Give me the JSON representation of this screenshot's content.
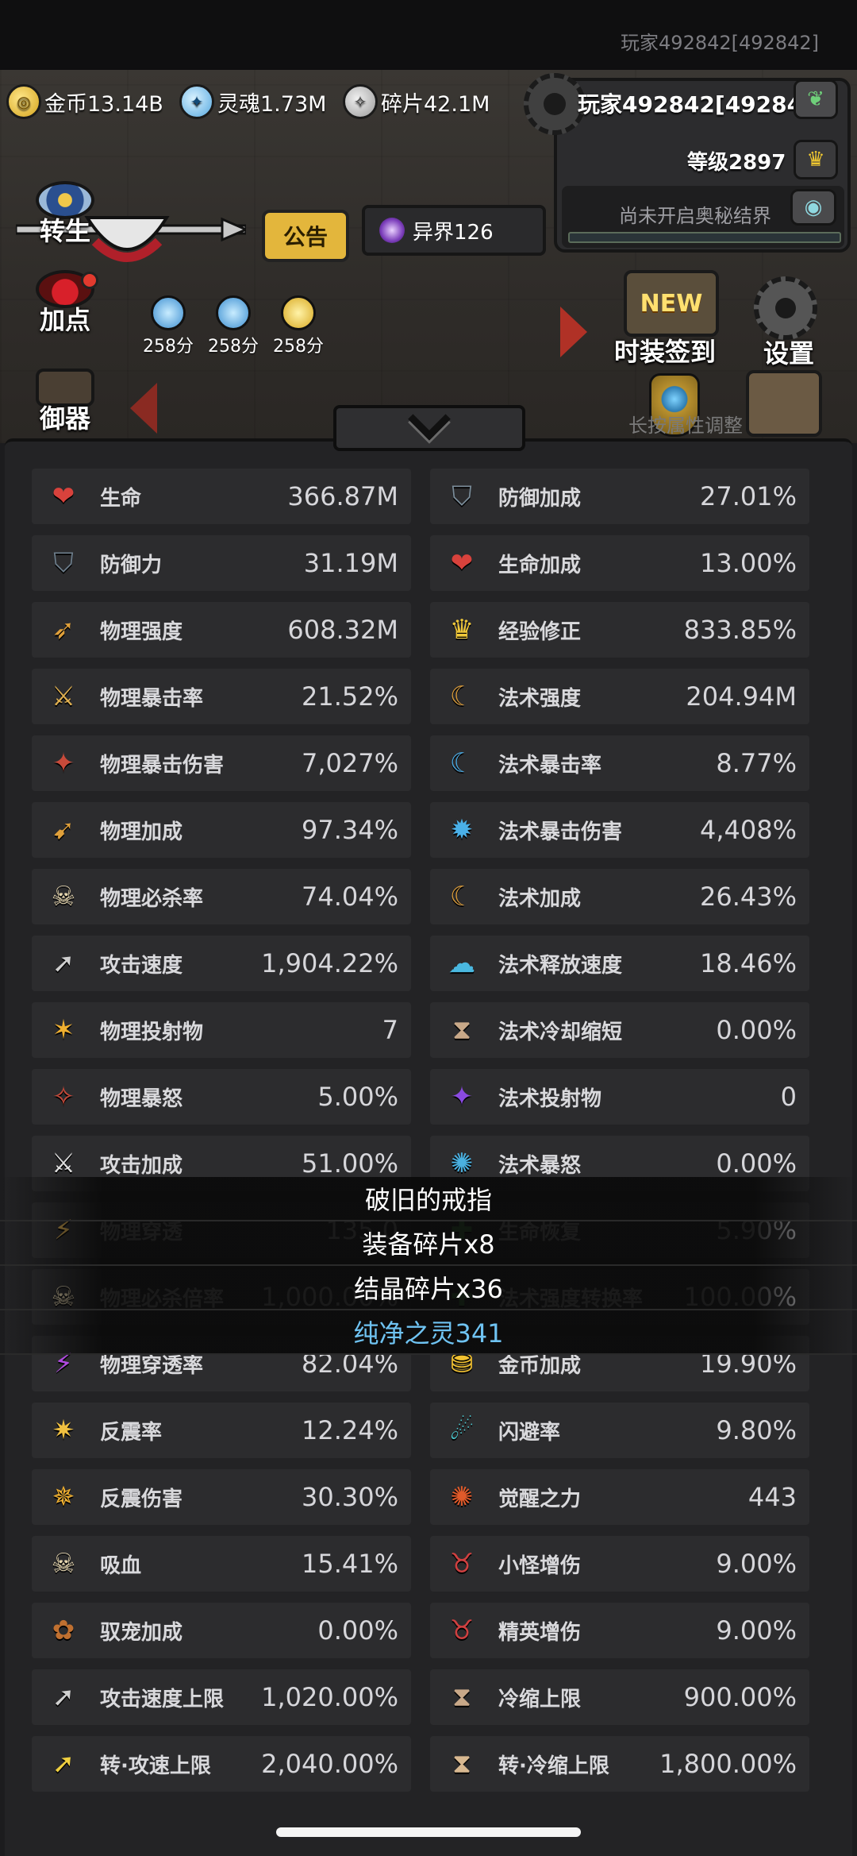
{
  "topbar": {
    "player_id_text": "玩家492842[492842]"
  },
  "resources": {
    "gold": "金币13.14B",
    "soul": "灵魂1.73M",
    "shard": "碎片42.1M"
  },
  "player": {
    "name": "玩家492842[492842]",
    "level": "等级2897",
    "secret_realm": "尚未开启奥秘结界"
  },
  "header_buttons": {
    "notice": "公告",
    "otherworld": "异界126"
  },
  "side_menu": {
    "rebirth": "转生",
    "add_points": "加点",
    "defense": "御器"
  },
  "buffs": [
    {
      "icon": "soul-buff-icon",
      "label": "258分"
    },
    {
      "icon": "soul-buff-icon",
      "label": "258分"
    },
    {
      "icon": "gold-buff-icon",
      "label": "258分"
    }
  ],
  "right_menu": {
    "new_badge": "NEW",
    "equip_signin": "时装签到",
    "settings": "设置",
    "faded_text": "长按属性调整"
  },
  "stats": [
    {
      "icon": "heart-icon",
      "glyph": "❤",
      "color": "#d8423c",
      "label": "生命",
      "value": "366.87M"
    },
    {
      "icon": "defense-plus-icon",
      "glyph": "⛉",
      "color": "#7b8d9a",
      "label": "防御加成",
      "value": "27.01%"
    },
    {
      "icon": "shield-icon",
      "glyph": "⛉",
      "color": "#6e7f8d",
      "label": "防御力",
      "value": "31.19M"
    },
    {
      "icon": "heart-plus-icon",
      "glyph": "❤",
      "color": "#d8423c",
      "label": "生命加成",
      "value": "13.00%"
    },
    {
      "icon": "sword-icon",
      "glyph": "➶",
      "color": "#e0a03a",
      "label": "物理强度",
      "value": "608.32M"
    },
    {
      "icon": "crown-icon",
      "glyph": "♛",
      "color": "#f0c83a",
      "label": "经验修正",
      "value": "833.85%"
    },
    {
      "icon": "crit-sword-icon",
      "glyph": "⚔",
      "color": "#e0b050",
      "label": "物理暴击率",
      "value": "21.52%"
    },
    {
      "icon": "magic-claw-icon",
      "glyph": "☾",
      "color": "#d89a3a",
      "label": "法术强度",
      "value": "204.94M"
    },
    {
      "icon": "crit-damage-icon",
      "glyph": "✦",
      "color": "#c84a3a",
      "label": "物理暴击伤害",
      "value": "7,027%"
    },
    {
      "icon": "magic-crit-icon",
      "glyph": "☾",
      "color": "#4aa8e0",
      "label": "法术暴击率",
      "value": "8.77%"
    },
    {
      "icon": "phys-bonus-icon",
      "glyph": "➹",
      "color": "#e0a03a",
      "label": "物理加成",
      "value": "97.34%"
    },
    {
      "icon": "magic-crit-damage-icon",
      "glyph": "✹",
      "color": "#4ab0e8",
      "label": "法术暴击伤害",
      "value": "4,408%"
    },
    {
      "icon": "skull-icon",
      "glyph": "☠",
      "color": "#e8d8b0",
      "label": "物理必杀率",
      "value": "74.04%"
    },
    {
      "icon": "magic-bonus-icon",
      "glyph": "☾",
      "color": "#d89a3a",
      "label": "法术加成",
      "value": "26.43%"
    },
    {
      "icon": "attack-speed-icon",
      "glyph": "➚",
      "color": "#d0d0d0",
      "label": "攻击速度",
      "value": "1,904.22%"
    },
    {
      "icon": "cast-speed-icon",
      "glyph": "☁",
      "color": "#4ab8e0",
      "label": "法术释放速度",
      "value": "18.46%"
    },
    {
      "icon": "projectile-icon",
      "glyph": "✶",
      "color": "#f0b030",
      "label": "物理投射物",
      "value": "7"
    },
    {
      "icon": "hourglass-icon",
      "glyph": "⧗",
      "color": "#c8a888",
      "label": "法术冷却缩短",
      "value": "0.00%"
    },
    {
      "icon": "rage-icon",
      "glyph": "✧",
      "color": "#c84a3a",
      "label": "物理暴怒",
      "value": "5.00%"
    },
    {
      "icon": "magic-projectile-icon",
      "glyph": "✦",
      "color": "#8a4ae0",
      "label": "法术投射物",
      "value": "0"
    },
    {
      "icon": "crossed-swords-icon",
      "glyph": "⚔",
      "color": "#e0e0e0",
      "label": "攻击加成",
      "value": "51.00%"
    },
    {
      "icon": "magic-rage-icon",
      "glyph": "✺",
      "color": "#4ab0e0",
      "label": "法术暴怒",
      "value": "0.00%"
    },
    {
      "icon": "penetrate-icon",
      "glyph": "⚡",
      "color": "#e0b050",
      "label": "物理穿透",
      "value": "135.0"
    },
    {
      "icon": "regen-icon",
      "glyph": "✚",
      "color": "#50c050",
      "label": "生命恢复",
      "value": "5.90%"
    },
    {
      "icon": "skull-multiplier-icon",
      "glyph": "☠",
      "color": "#e8d8b0",
      "label": "物理必杀倍率",
      "value": "1,000.00%"
    },
    {
      "icon": "convert-icon",
      "glyph": "✚",
      "color": "#50c050",
      "label": "法术强度转换率",
      "value": "100.00%"
    },
    {
      "icon": "penetrate-rate-icon",
      "glyph": "⚡",
      "color": "#b04ae0",
      "label": "物理穿透率",
      "value": "82.04%"
    },
    {
      "icon": "coin-stack-icon",
      "glyph": "⛃",
      "color": "#f0c030",
      "label": "金币加成",
      "value": "19.90%"
    },
    {
      "icon": "reflect-icon",
      "glyph": "✷",
      "color": "#f0c040",
      "label": "反震率",
      "value": "12.24%"
    },
    {
      "icon": "dodge-icon",
      "glyph": "☄",
      "color": "#4ac8d0",
      "label": "闪避率",
      "value": "9.80%"
    },
    {
      "icon": "reflect-damage-icon",
      "glyph": "✵",
      "color": "#f0b030",
      "label": "反震伤害",
      "value": "30.30%"
    },
    {
      "icon": "awaken-icon",
      "glyph": "✺",
      "color": "#e05a2a",
      "label": "觉醒之力",
      "value": "443"
    },
    {
      "icon": "vampire-skull-icon",
      "glyph": "☠",
      "color": "#e8d8b0",
      "label": "吸血",
      "value": "15.41%"
    },
    {
      "icon": "demon-icon",
      "glyph": "♉",
      "color": "#d04040",
      "label": "小怪增伤",
      "value": "9.00%"
    },
    {
      "icon": "paw-icon",
      "glyph": "✿",
      "color": "#c07030",
      "label": "驭宠加成",
      "value": "0.00%"
    },
    {
      "icon": "elite-demon-icon",
      "glyph": "♉",
      "color": "#d04040",
      "label": "精英增伤",
      "value": "9.00%"
    },
    {
      "icon": "speed-cap-icon",
      "glyph": "➚",
      "color": "#d0d0d0",
      "label": "攻击速度上限",
      "value": "1,020.00%"
    },
    {
      "icon": "cd-cap-icon",
      "glyph": "⧗",
      "color": "#c8a888",
      "label": "冷缩上限",
      "value": "900.00%"
    },
    {
      "icon": "rebirth-speed-cap-icon",
      "glyph": "➚",
      "color": "#f0d040",
      "label": "转·攻速上限",
      "value": "2,040.00%"
    },
    {
      "icon": "rebirth-cd-cap-icon",
      "glyph": "⧗",
      "color": "#d8b890",
      "label": "转·冷缩上限",
      "value": "1,800.00%"
    }
  ],
  "drops": [
    {
      "text": "破旧的戒指",
      "rare": false
    },
    {
      "text": "装备碎片x8",
      "rare": false
    },
    {
      "text": "结晶碎片x36",
      "rare": false
    },
    {
      "text": "纯净之灵341",
      "rare": true
    }
  ]
}
